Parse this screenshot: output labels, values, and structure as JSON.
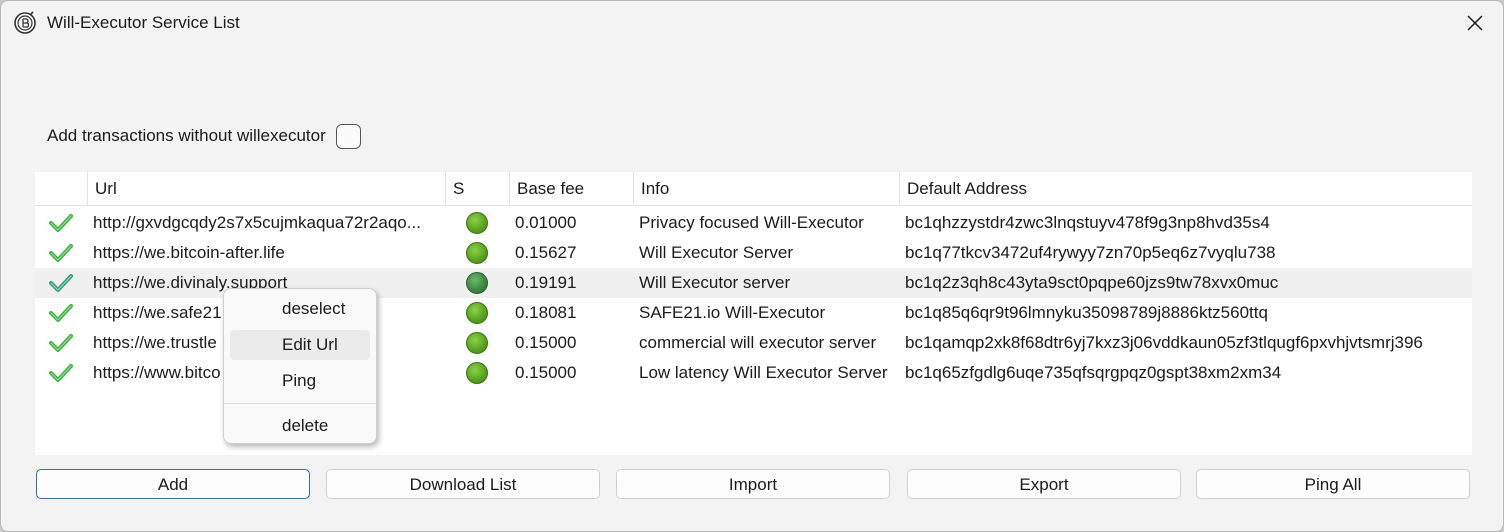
{
  "window": {
    "title": "Will-Executor Service List"
  },
  "options": {
    "no_willexecutor_label": "Add transactions without willexecutor"
  },
  "table": {
    "columns": [
      "",
      "Url",
      "S",
      "Base fee",
      "Info",
      "Default Address"
    ],
    "rows": [
      {
        "url": "http://gxvdgcqdy2s7x5cujmkaqua72r2aqo...",
        "status": "online",
        "fee": "0.01000",
        "info": "Privacy focused Will-Executor",
        "address": "bc1qhzzystdr4zwc3lnqstuyv478f9g3np8hvd35s4"
      },
      {
        "url": "https://we.bitcoin-after.life",
        "status": "online",
        "fee": "0.15627",
        "info": "Will Executor Server",
        "address": "bc1q77tkcv3472uf4rywyy7zn70p5eq6z7vyqlu738"
      },
      {
        "url": "https://we.divinaly.support",
        "status": "online",
        "fee": "0.19191",
        "info": "Will Executor server",
        "address": "bc1q2z3qh8c43yta9sct0pqpe60jzs9tw78xvx0muc"
      },
      {
        "url": "https://we.safe21",
        "status": "online",
        "fee": "0.18081",
        "info": "SAFE21.io Will-Executor",
        "address": "bc1q85q6qr9t96lmnyku35098789j8886ktz560ttq"
      },
      {
        "url": "https://we.trustle",
        "status": "online",
        "fee": "0.15000",
        "info": "commercial will executor server",
        "address": "bc1qamqp2xk8f68dtr6yj7kxz3j06vddkaun05zf3tlqugf6pxvhjvtsmrj396"
      },
      {
        "url": "https://www.bitco",
        "status": "online",
        "fee": "0.15000",
        "info": "Low latency Will Executor Server",
        "address": "bc1q65zfgdlg6uqe735qfsqrgpqz0gspt38xm2xm34"
      }
    ]
  },
  "buttons": {
    "add": "Add",
    "download": "Download List",
    "import": "Import",
    "export": "Export",
    "ping_all": "Ping All"
  },
  "context_menu": {
    "deselect": "deselect",
    "edit_url": "Edit Url",
    "ping": "Ping",
    "delete": "delete"
  },
  "colors": {
    "status_green": "#5aa61f",
    "check_green": "#3fb03f",
    "primary_border": "#3a6ea5"
  }
}
